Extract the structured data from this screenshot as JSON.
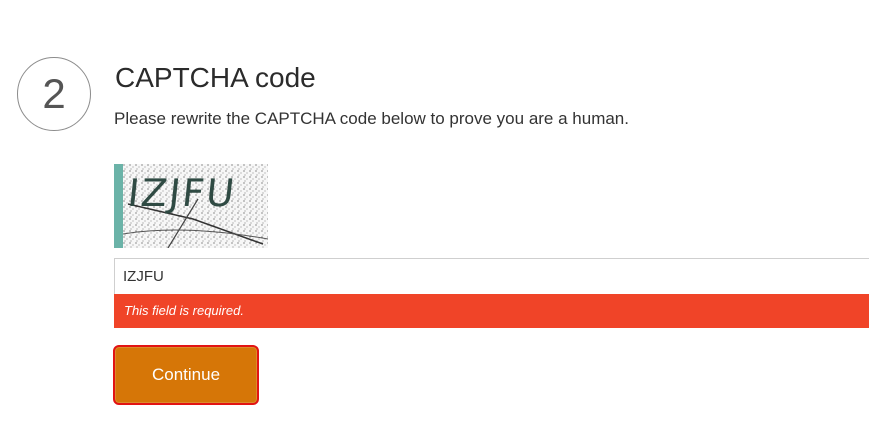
{
  "step": {
    "number": "2",
    "title": "CAPTCHA code",
    "instructions": "Please rewrite the CAPTCHA code below to prove you are a human."
  },
  "captcha": {
    "image_text": "IZJFU",
    "accent_color": "#6bb3a8"
  },
  "form": {
    "captcha_input_value": "IZJFU",
    "error_message": "This field is required.",
    "error_color": "#f04428",
    "continue_label": "Continue",
    "continue_color": "#d67607"
  }
}
